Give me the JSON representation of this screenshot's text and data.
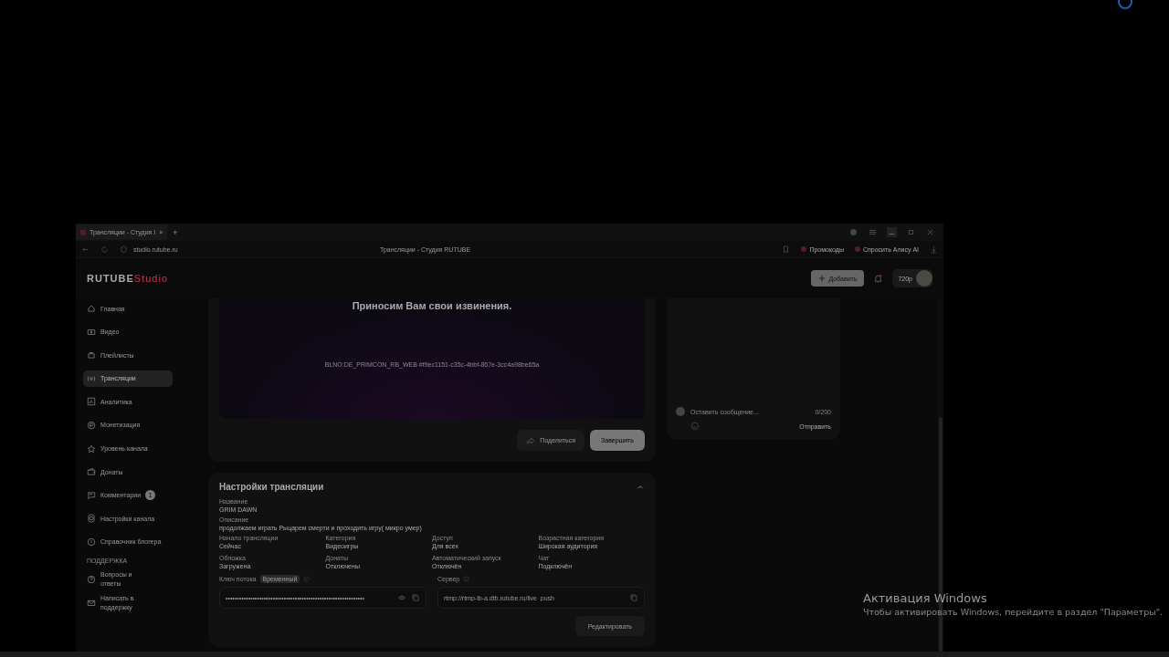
{
  "browser": {
    "tab": {
      "title": "Трансляции - Студия I",
      "close": "×"
    },
    "new_tab": "+",
    "address": "studio.rutube.ru",
    "page_title": "Трансляции - Студия RUTUBE",
    "bookmarks": [
      "Промокоды",
      "Спросить Алису AI"
    ]
  },
  "header": {
    "logo": "RUTUBE",
    "logo_suffix": "Studio",
    "add_button": "Добавить",
    "quality": "720p",
    "notification": true
  },
  "sidebar": {
    "items": [
      {
        "label": "Главная",
        "selected": false
      },
      {
        "label": "Видео",
        "selected": false
      },
      {
        "label": "Плейлисты",
        "selected": false
      },
      {
        "label": "Трансляции",
        "selected": true
      },
      {
        "label": "Аналитика",
        "selected": false
      },
      {
        "label": "Монетизация",
        "selected": false
      },
      {
        "label": "Уровень канала",
        "selected": false
      },
      {
        "label": "Донаты",
        "selected": false
      },
      {
        "label": "Комментарии",
        "selected": false,
        "badge": "1"
      },
      {
        "label": "Настройки канала",
        "selected": false
      },
      {
        "label": "Справочник блогера",
        "selected": false
      }
    ],
    "section": "ПОДДЕРЖКА",
    "support_items": [
      {
        "label": "Вопросы и ответы"
      },
      {
        "label": "Написать в поддержку"
      }
    ]
  },
  "player": {
    "message": "Приносим Вам свои извинения.",
    "code": "BLNO:DE_PRIMCON_RB_WEB #f9ec1151-c35c-4bbf-867e-3cc4a98be65a",
    "share_button": "Поделиться",
    "finish_button": "Завершить"
  },
  "chat": {
    "placeholder": "Оставить сообщение...",
    "counter": "0/200",
    "send": "Отправить"
  },
  "settings": {
    "title": "Настройки трансляции",
    "expanded": true,
    "name": {
      "label": "Название",
      "value": "GRIM DAWN"
    },
    "description": {
      "label": "Описание",
      "value": "продолжаем играть Рыцарем смерти и проходить игру( микро умер)"
    },
    "fields": [
      {
        "label": "Начало трансляции",
        "value": "Сейчас"
      },
      {
        "label": "Категория",
        "value": "Видеоигры"
      },
      {
        "label": "Доступ",
        "value": "Для всех"
      },
      {
        "label": "Возрастная категория",
        "value": "Широкая аудитория"
      },
      {
        "label": "Обложка",
        "value": "Загружена"
      },
      {
        "label": "Донаты",
        "value": "Отключены"
      },
      {
        "label": "Автоматический запуск",
        "value": "Отключён"
      },
      {
        "label": "Чат",
        "value": "Подключён"
      }
    ],
    "key": {
      "label": "Ключ потока",
      "badge": "Временный",
      "value": "••••••••••••••••••••••••••••••••••••••••••••••••••••••••••••••"
    },
    "server": {
      "label": "Сервер",
      "value": "rtmp://rtmp-lb-a.dtb.rutube.ru/live_push"
    },
    "edit_button": "Редактировать"
  },
  "activation": {
    "title": "Активация Windows",
    "text": "Чтобы активировать Windows, перейдите в раздел \"Параметры\"."
  }
}
